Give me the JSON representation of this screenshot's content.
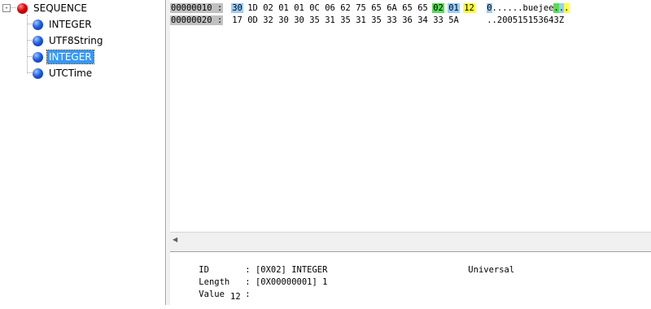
{
  "tree": {
    "root": {
      "label": "SEQUENCE",
      "expander": "-"
    },
    "children": [
      {
        "label": "INTEGER",
        "selected": false
      },
      {
        "label": "UTF8String",
        "selected": false
      },
      {
        "label": "INTEGER",
        "selected": true
      },
      {
        "label": "UTCTime",
        "selected": false
      }
    ]
  },
  "hex": {
    "rows": [
      {
        "offset": "00000010 :",
        "bytes": [
          "30",
          "1D",
          "02",
          "01",
          "01",
          "0C",
          "06",
          "62",
          "75",
          "65",
          "6A",
          "65",
          "65",
          "02",
          "01",
          "12"
        ],
        "highlights": [
          "blue",
          "",
          "",
          "",
          "",
          "",
          "",
          "",
          "",
          "",
          "",
          "",
          "",
          "green",
          "blue",
          "yellow"
        ],
        "ascii": [
          "0",
          ".",
          ".",
          ".",
          ".",
          ".",
          ".",
          "b",
          "u",
          "e",
          "j",
          "e",
          "e",
          ".",
          ".",
          "."
        ],
        "ascii_highlights": [
          "blue",
          "",
          "",
          "",
          "",
          "",
          "",
          "",
          "",
          "",
          "",
          "",
          "",
          "green",
          "blue",
          "yellow"
        ]
      },
      {
        "offset": "00000020 :",
        "bytes": [
          "17",
          "0D",
          "32",
          "30",
          "30",
          "35",
          "31",
          "35",
          "31",
          "35",
          "33",
          "36",
          "34",
          "33",
          "5A"
        ],
        "highlights": [
          "",
          "",
          "",
          "",
          "",
          "",
          "",
          "",
          "",
          "",
          "",
          "",
          "",
          "",
          ""
        ],
        "ascii": [
          ".",
          ".",
          "2",
          "0",
          "0",
          "5",
          "1",
          "5",
          "1",
          "5",
          "3",
          "6",
          "4",
          "3",
          "Z"
        ],
        "ascii_highlights": [
          "",
          "",
          "",
          "",
          "",
          "",
          "",
          "",
          "",
          "",
          "",
          "",
          "",
          "",
          ""
        ]
      }
    ]
  },
  "info": {
    "id_label": "ID",
    "id_value": ": [0X02] INTEGER",
    "class_value": "Universal",
    "length_label": "Length",
    "length_value": ": [0X00000001] 1",
    "value_label": "Value",
    "value_sep": ":",
    "value_content": "12"
  },
  "colors": {
    "selection": "#3399ff",
    "hl_blue": "#99ccff",
    "hl_green": "#55dd55",
    "hl_yellow": "#ffff33",
    "offset_bg": "#c0c0c0"
  }
}
